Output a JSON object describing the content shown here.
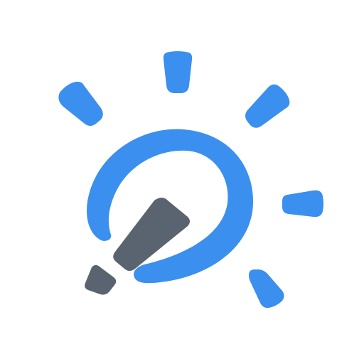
{
  "icon": {
    "name": "lightbulb-idea-icon",
    "colors": {
      "background": "#ffffff",
      "primary": "#3b8fee",
      "secondary": "#5a6470"
    }
  }
}
